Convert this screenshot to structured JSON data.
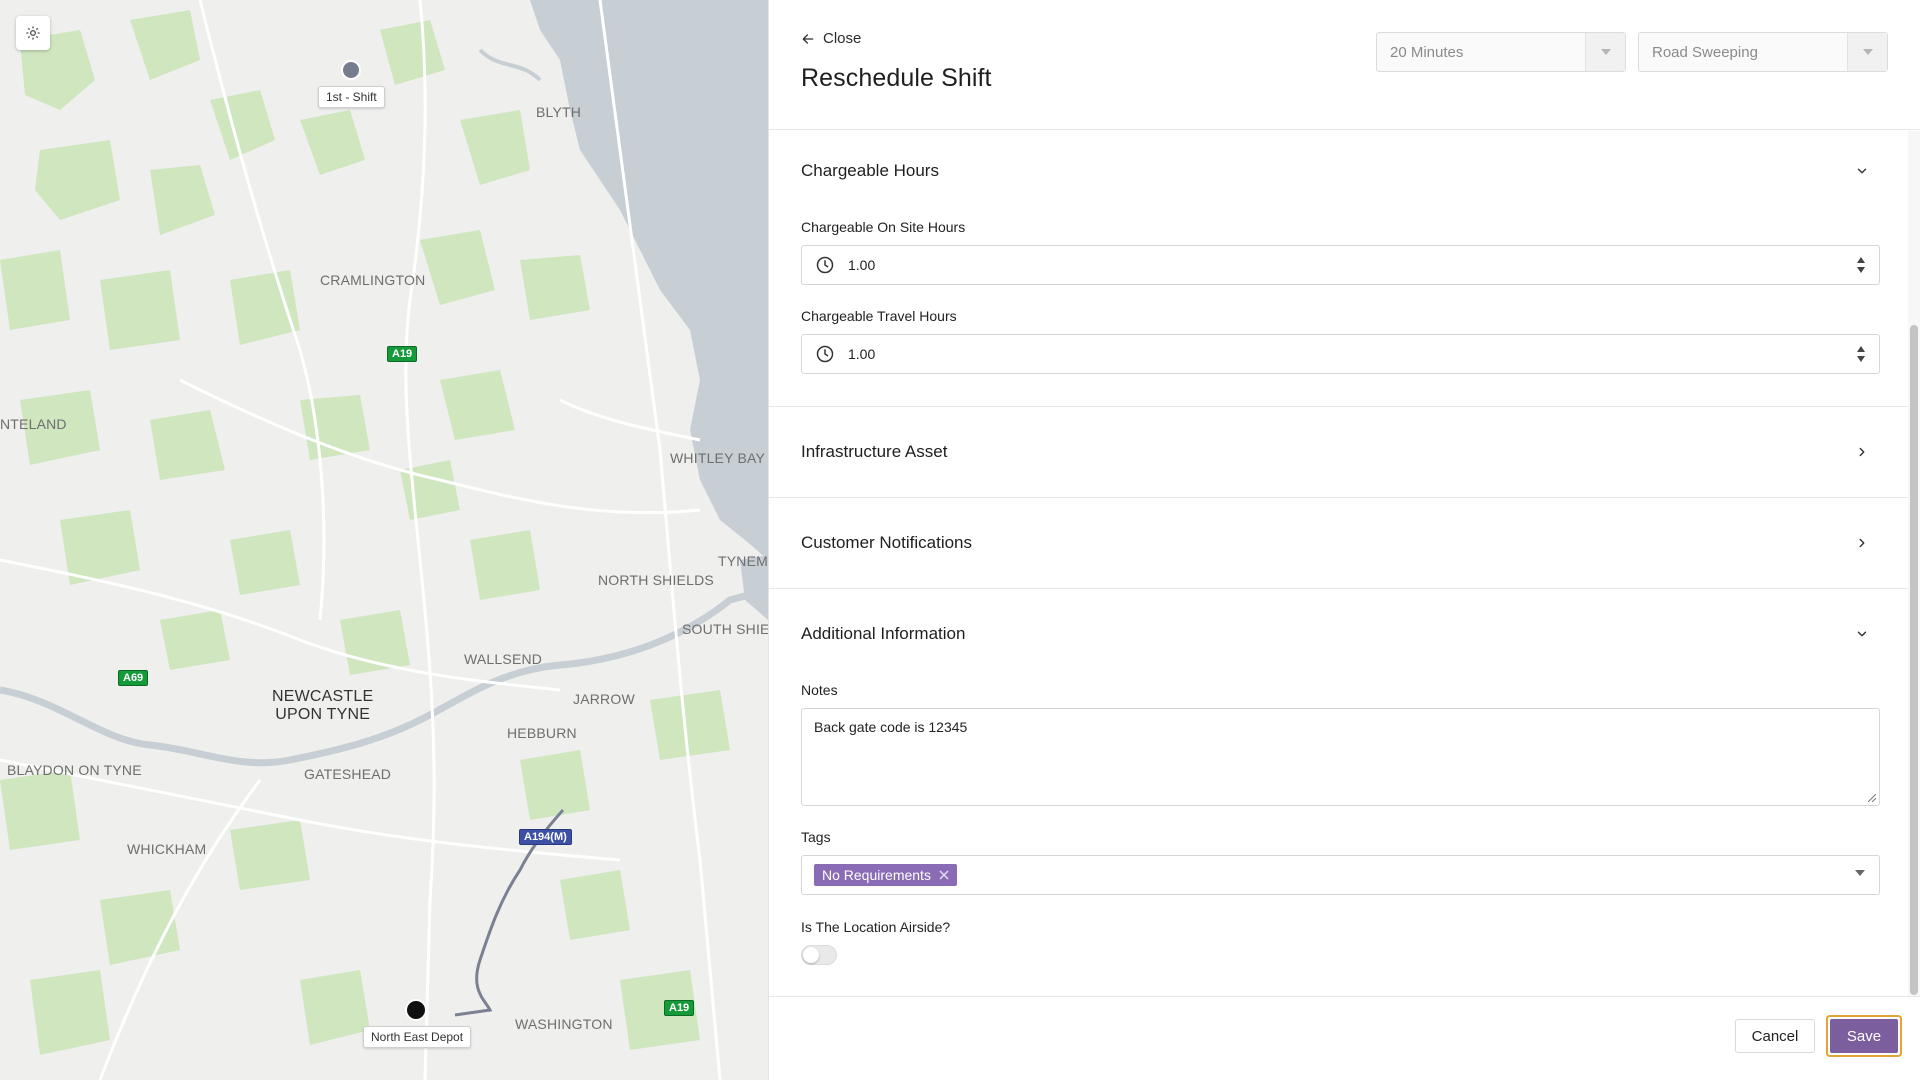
{
  "map": {
    "places": {
      "blyth": "BLYTH",
      "cramlington": "CRAMLINGTON",
      "ponteland": "NTELAND",
      "whitley_bay": "WHITLEY BAY",
      "north_shields": "NORTH SHIELDS",
      "tynemouth": "TYNEMO",
      "south_shields": "SOUTH SHIEL",
      "wallsend": "WALLSEND",
      "jarrow": "JARROW",
      "hebburn": "HEBBURN",
      "newcastle_line1": "NEWCASTLE",
      "newcastle_line2": "UPON TYNE",
      "gateshead": "GATESHEAD",
      "blaydon": "BLAYDON ON TYNE",
      "whickham": "WHICKHAM",
      "washington": "WASHINGTON"
    },
    "roads": {
      "a19_north": "A19",
      "a69": "A69",
      "a194m": "A194(M)",
      "a19_south": "A19"
    },
    "markers": {
      "shift_label": "1st - Shift",
      "depot_label": "North East Depot"
    }
  },
  "header": {
    "close_label": "Close",
    "title": "Reschedule Shift",
    "duration_select": "20 Minutes",
    "service_select": "Road Sweeping"
  },
  "sections": {
    "chargeable_hours": {
      "title": "Chargeable Hours",
      "on_site_label": "Chargeable On Site Hours",
      "on_site_value": "1.00",
      "travel_label": "Chargeable Travel Hours",
      "travel_value": "1.00"
    },
    "infrastructure_asset": {
      "title": "Infrastructure Asset"
    },
    "customer_notifications": {
      "title": "Customer Notifications"
    },
    "additional_information": {
      "title": "Additional Information",
      "notes_label": "Notes",
      "notes_value": "Back gate code is 12345",
      "tags_label": "Tags",
      "tags": [
        "No Requirements"
      ],
      "airside_label": "Is The Location Airside?",
      "airside_on": false
    }
  },
  "footer": {
    "cancel_label": "Cancel",
    "save_label": "Save"
  },
  "colors": {
    "accent": "#7a5e9d",
    "tag": "#8a6bb5",
    "focus_ring": "#e3a23a",
    "map_land": "#efefed",
    "map_green": "#cfe6bf",
    "map_water": "#c7cfd4",
    "road_green": "#159a3a",
    "road_blue": "#3d50a5"
  }
}
